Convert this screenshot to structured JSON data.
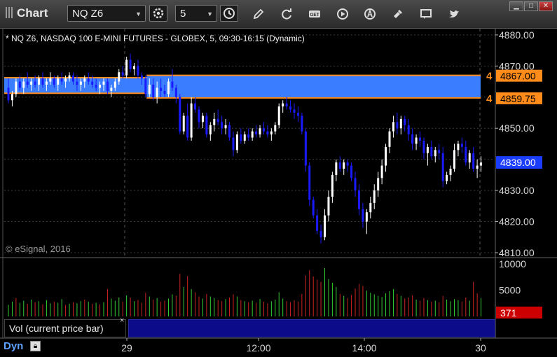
{
  "toolbar": {
    "title": "Chart",
    "symbol": "NQ Z6",
    "interval": "5",
    "icons": [
      "settings-gear-icon",
      "clock-icon",
      "pencil-icon",
      "refresh-icon",
      "get-icon",
      "play-icon",
      "alert-icon",
      "tools-icon",
      "comment-icon",
      "twitter-icon"
    ],
    "get_label": "GET"
  },
  "window": {
    "minimize": "▁",
    "maximize": "□",
    "close": "✕"
  },
  "chart": {
    "header": "* NQ Z6, NASDAQ 100 E-MINI FUTURES - GLOBEX, 5, 09:30-16:15 (Dynamic)",
    "watermark": "© eSignal, 2016",
    "colors": {
      "up": "#ffffff",
      "down": "#1a1aff",
      "band": "#3a7dff",
      "level": "#ff8c1a",
      "current": "#1a3dff",
      "vol_up": "#33cc33",
      "vol_down": "#cc2222"
    }
  },
  "chart_data": {
    "type": "candlestick",
    "y_ticks": [
      "4880.00",
      "4870.00",
      "4850.00",
      "4830.00",
      "4820.00",
      "4810.00"
    ],
    "ylim": [
      4808,
      4882
    ],
    "x_ticks": [
      "29",
      "12:00",
      "14:00",
      "30"
    ],
    "levels": [
      {
        "label": "4867.00",
        "marker": "4",
        "value": 4867.0
      },
      {
        "label": "4859.75",
        "marker": "4",
        "value": 4859.75
      }
    ],
    "current_price": {
      "label": "4839.00",
      "value": 4839.0
    },
    "bands": [
      {
        "from": 4866.25,
        "to": 4861.25,
        "start_bar": 0,
        "end_bar": 37
      },
      {
        "from": 4867.0,
        "to": 4859.75,
        "start_bar": 37,
        "end_bar": 147
      }
    ],
    "candles": [
      [
        4863,
        4866,
        4858,
        4859
      ],
      [
        4859,
        4862,
        4857,
        4861
      ],
      [
        4861,
        4866,
        4860,
        4865
      ],
      [
        4865,
        4867,
        4862,
        4863
      ],
      [
        4863,
        4866,
        4861,
        4865
      ],
      [
        4865,
        4868,
        4863,
        4864
      ],
      [
        4864,
        4866,
        4862,
        4865
      ],
      [
        4865,
        4867,
        4863,
        4864
      ],
      [
        4864,
        4867,
        4862,
        4866
      ],
      [
        4866,
        4868,
        4863,
        4864
      ],
      [
        4864,
        4866,
        4862,
        4865
      ],
      [
        4865,
        4868,
        4864,
        4866
      ],
      [
        4866,
        4867,
        4863,
        4864
      ],
      [
        4864,
        4867,
        4862,
        4866
      ],
      [
        4866,
        4868,
        4864,
        4865
      ],
      [
        4865,
        4867,
        4863,
        4866
      ],
      [
        4866,
        4868,
        4865,
        4867
      ],
      [
        4867,
        4868,
        4864,
        4865
      ],
      [
        4865,
        4867,
        4862,
        4864
      ],
      [
        4864,
        4866,
        4862,
        4865
      ],
      [
        4865,
        4867,
        4863,
        4866
      ],
      [
        4866,
        4868,
        4864,
        4865
      ],
      [
        4865,
        4867,
        4863,
        4864
      ],
      [
        4864,
        4866,
        4862,
        4863
      ],
      [
        4863,
        4865,
        4861,
        4864
      ],
      [
        4864,
        4866,
        4862,
        4865
      ],
      [
        4865,
        4866,
        4861,
        4862
      ],
      [
        4862,
        4864,
        4860,
        4863
      ],
      [
        4863,
        4866,
        4862,
        4865
      ],
      [
        4865,
        4869,
        4864,
        4868
      ],
      [
        4868,
        4870,
        4866,
        4867
      ],
      [
        4867,
        4873,
        4866,
        4872
      ],
      [
        4872,
        4874,
        4868,
        4869
      ],
      [
        4869,
        4871,
        4867,
        4870
      ],
      [
        4870,
        4872,
        4866,
        4867
      ],
      [
        4867,
        4868,
        4864,
        4866
      ],
      [
        4866,
        4867,
        4860,
        4861
      ],
      [
        4861,
        4866,
        4860,
        4864
      ],
      [
        4864,
        4866,
        4859,
        4860
      ],
      [
        4860,
        4865,
        4858,
        4863
      ],
      [
        4863,
        4866,
        4860,
        4862
      ],
      [
        4862,
        4864,
        4860,
        4861
      ],
      [
        4861,
        4866,
        4860,
        4865
      ],
      [
        4865,
        4869,
        4862,
        4863
      ],
      [
        4863,
        4864,
        4858,
        4860
      ],
      [
        4860,
        4861,
        4848,
        4849
      ],
      [
        4849,
        4855,
        4848,
        4854
      ],
      [
        4854,
        4858,
        4846,
        4847
      ],
      [
        4847,
        4860,
        4846,
        4858
      ],
      [
        4858,
        4860,
        4855,
        4856
      ],
      [
        4856,
        4857,
        4850,
        4852
      ],
      [
        4852,
        4855,
        4850,
        4854
      ],
      [
        4854,
        4855,
        4847,
        4848
      ],
      [
        4848,
        4852,
        4846,
        4851
      ],
      [
        4851,
        4855,
        4849,
        4853
      ],
      [
        4853,
        4856,
        4851,
        4852
      ],
      [
        4852,
        4854,
        4848,
        4850
      ],
      [
        4850,
        4853,
        4848,
        4851
      ],
      [
        4851,
        4852,
        4846,
        4847
      ],
      [
        4847,
        4849,
        4841,
        4843
      ],
      [
        4843,
        4849,
        4842,
        4848
      ],
      [
        4848,
        4850,
        4845,
        4846
      ],
      [
        4846,
        4849,
        4845,
        4848
      ],
      [
        4848,
        4850,
        4846,
        4847
      ],
      [
        4847,
        4850,
        4846,
        4849
      ],
      [
        4849,
        4851,
        4847,
        4848
      ],
      [
        4848,
        4851,
        4847,
        4850
      ],
      [
        4850,
        4852,
        4848,
        4849
      ],
      [
        4849,
        4851,
        4847,
        4848
      ],
      [
        4848,
        4850,
        4846,
        4849
      ],
      [
        4849,
        4852,
        4848,
        4851
      ],
      [
        4851,
        4858,
        4850,
        4857
      ],
      [
        4857,
        4859,
        4855,
        4858
      ],
      [
        4858,
        4860,
        4856,
        4857
      ],
      [
        4857,
        4859,
        4855,
        4856
      ],
      [
        4856,
        4858,
        4853,
        4855
      ],
      [
        4855,
        4857,
        4852,
        4854
      ],
      [
        4854,
        4855,
        4848,
        4849
      ],
      [
        4849,
        4850,
        4836,
        4838
      ],
      [
        4838,
        4839,
        4825,
        4827
      ],
      [
        4827,
        4828,
        4821,
        4822
      ],
      [
        4822,
        4824,
        4816,
        4817
      ],
      [
        4817,
        4819,
        4813,
        4815
      ],
      [
        4815,
        4824,
        4814,
        4822
      ],
      [
        4822,
        4830,
        4820,
        4828
      ],
      [
        4828,
        4836,
        4826,
        4835
      ],
      [
        4835,
        4840,
        4833,
        4839
      ],
      [
        4839,
        4841,
        4836,
        4837
      ],
      [
        4837,
        4840,
        4835,
        4839
      ],
      [
        4839,
        4840,
        4836,
        4838
      ],
      [
        4838,
        4839,
        4833,
        4834
      ],
      [
        4834,
        4836,
        4828,
        4830
      ],
      [
        4830,
        4832,
        4822,
        4824
      ],
      [
        4824,
        4826,
        4818,
        4820
      ],
      [
        4820,
        4824,
        4816,
        4823
      ],
      [
        4823,
        4828,
        4821,
        4826
      ],
      [
        4826,
        4832,
        4824,
        4830
      ],
      [
        4830,
        4836,
        4828,
        4834
      ],
      [
        4834,
        4840,
        4832,
        4838
      ],
      [
        4838,
        4845,
        4836,
        4844
      ],
      [
        4844,
        4850,
        4842,
        4849
      ],
      [
        4849,
        4854,
        4847,
        4852
      ],
      [
        4852,
        4855,
        4848,
        4850
      ],
      [
        4850,
        4854,
        4848,
        4853
      ],
      [
        4853,
        4854,
        4849,
        4851
      ],
      [
        4851,
        4853,
        4846,
        4848
      ],
      [
        4848,
        4850,
        4843,
        4845
      ],
      [
        4845,
        4848,
        4843,
        4847
      ],
      [
        4847,
        4849,
        4844,
        4846
      ],
      [
        4846,
        4847,
        4840,
        4842
      ],
      [
        4842,
        4845,
        4838,
        4844
      ],
      [
        4844,
        4846,
        4840,
        4841
      ],
      [
        4841,
        4844,
        4839,
        4843
      ],
      [
        4843,
        4845,
        4840,
        4842
      ],
      [
        4842,
        4844,
        4831,
        4833
      ],
      [
        4833,
        4836,
        4832,
        4835
      ],
      [
        4835,
        4838,
        4833,
        4837
      ],
      [
        4837,
        4845,
        4836,
        4843
      ],
      [
        4843,
        4846,
        4841,
        4845
      ],
      [
        4845,
        4847,
        4842,
        4844
      ],
      [
        4844,
        4846,
        4838,
        4839
      ],
      [
        4839,
        4843,
        4837,
        4842
      ],
      [
        4842,
        4844,
        4836,
        4837
      ],
      [
        4837,
        4840,
        4834,
        4838
      ],
      [
        4838,
        4841,
        4836,
        4839
      ]
    ],
    "volume_ylim": [
      0,
      10000
    ],
    "volume_ticks": [
      "10000",
      "5000"
    ],
    "current_volume": {
      "label": "371",
      "value": 371
    },
    "volume": [
      [
        2200,
        1
      ],
      [
        2800,
        1
      ],
      [
        3500,
        0
      ],
      [
        2600,
        1
      ],
      [
        3000,
        1
      ],
      [
        2400,
        0
      ],
      [
        3200,
        1
      ],
      [
        2700,
        0
      ],
      [
        2900,
        1
      ],
      [
        2300,
        0
      ],
      [
        3100,
        1
      ],
      [
        2500,
        1
      ],
      [
        2800,
        0
      ],
      [
        2600,
        1
      ],
      [
        3300,
        1
      ],
      [
        2200,
        0
      ],
      [
        2400,
        1
      ],
      [
        2700,
        0
      ],
      [
        2500,
        1
      ],
      [
        2900,
        1
      ],
      [
        3200,
        0
      ],
      [
        2800,
        1
      ],
      [
        2400,
        0
      ],
      [
        2600,
        1
      ],
      [
        2300,
        0
      ],
      [
        2700,
        1
      ],
      [
        5200,
        0
      ],
      [
        3400,
        1
      ],
      [
        3000,
        1
      ],
      [
        3600,
        1
      ],
      [
        2800,
        0
      ],
      [
        4000,
        1
      ],
      [
        3600,
        0
      ],
      [
        2900,
        1
      ],
      [
        3100,
        0
      ],
      [
        2600,
        0
      ],
      [
        4500,
        0
      ],
      [
        3800,
        1
      ],
      [
        3200,
        0
      ],
      [
        3500,
        1
      ],
      [
        2800,
        0
      ],
      [
        3000,
        0
      ],
      [
        3400,
        1
      ],
      [
        4200,
        1
      ],
      [
        3900,
        0
      ],
      [
        8100,
        0
      ],
      [
        5600,
        1
      ],
      [
        7700,
        0
      ],
      [
        5200,
        1
      ],
      [
        4600,
        0
      ],
      [
        3800,
        0
      ],
      [
        3400,
        1
      ],
      [
        4300,
        0
      ],
      [
        3800,
        1
      ],
      [
        3500,
        1
      ],
      [
        3100,
        0
      ],
      [
        2900,
        0
      ],
      [
        3300,
        1
      ],
      [
        3600,
        0
      ],
      [
        4200,
        0
      ],
      [
        3800,
        1
      ],
      [
        3100,
        0
      ],
      [
        2900,
        1
      ],
      [
        2700,
        0
      ],
      [
        3000,
        1
      ],
      [
        2600,
        0
      ],
      [
        3300,
        1
      ],
      [
        2800,
        0
      ],
      [
        2500,
        0
      ],
      [
        2900,
        1
      ],
      [
        3200,
        1
      ],
      [
        4600,
        1
      ],
      [
        3400,
        1
      ],
      [
        2900,
        0
      ],
      [
        2700,
        0
      ],
      [
        3100,
        0
      ],
      [
        2800,
        0
      ],
      [
        4300,
        0
      ],
      [
        7800,
        0
      ],
      [
        8800,
        0
      ],
      [
        7600,
        0
      ],
      [
        7000,
        0
      ],
      [
        6600,
        0
      ],
      [
        9200,
        1
      ],
      [
        7100,
        1
      ],
      [
        6400,
        1
      ],
      [
        5600,
        1
      ],
      [
        4300,
        0
      ],
      [
        3900,
        1
      ],
      [
        3500,
        0
      ],
      [
        4100,
        0
      ],
      [
        5300,
        0
      ],
      [
        6200,
        0
      ],
      [
        5800,
        0
      ],
      [
        4900,
        1
      ],
      [
        4500,
        1
      ],
      [
        4200,
        1
      ],
      [
        3900,
        1
      ],
      [
        3700,
        1
      ],
      [
        4400,
        1
      ],
      [
        4800,
        1
      ],
      [
        5200,
        1
      ],
      [
        4300,
        0
      ],
      [
        3900,
        1
      ],
      [
        3400,
        0
      ],
      [
        3600,
        0
      ],
      [
        4000,
        0
      ],
      [
        3200,
        1
      ],
      [
        3000,
        0
      ],
      [
        3500,
        0
      ],
      [
        3100,
        1
      ],
      [
        2800,
        0
      ],
      [
        3000,
        1
      ],
      [
        2700,
        0
      ],
      [
        3900,
        0
      ],
      [
        3200,
        1
      ],
      [
        2900,
        1
      ],
      [
        3300,
        1
      ],
      [
        3100,
        1
      ],
      [
        2800,
        0
      ],
      [
        3600,
        0
      ],
      [
        3000,
        1
      ],
      [
        6600,
        0
      ],
      [
        4400,
        0
      ],
      [
        3500,
        1
      ]
    ]
  }
}
